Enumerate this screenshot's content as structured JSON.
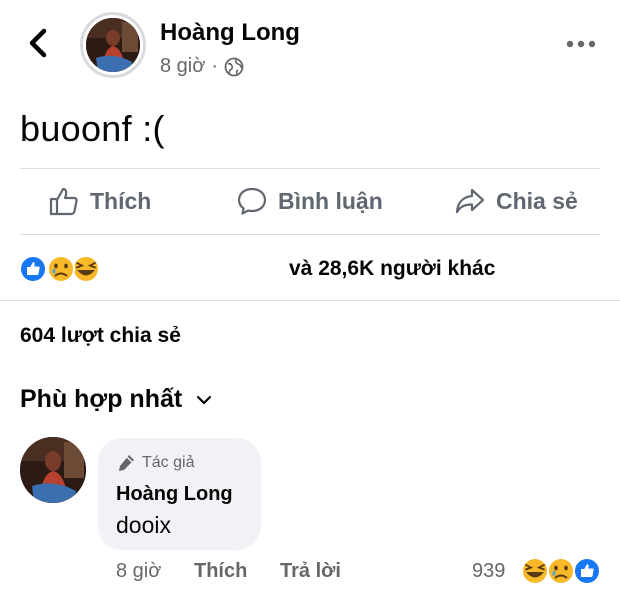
{
  "header": {
    "author_name": "Hoàng Long",
    "time": "8 giờ",
    "separator": "·",
    "icons": {
      "back": "chevron-left-icon",
      "privacy": "globe-icon",
      "more": "more-horizontal-icon"
    }
  },
  "post": {
    "text": "buoonf :("
  },
  "actions": {
    "like_label": "Thích",
    "comment_label": "Bình luận",
    "share_label": "Chia sẻ",
    "icons": {
      "like": "thumbs-up-icon",
      "comment": "comment-icon",
      "share": "share-icon"
    }
  },
  "reactions": {
    "summary": "và 28,6K người khác",
    "types": [
      "like",
      "sad",
      "haha"
    ]
  },
  "shares": {
    "text": "604 lượt chia sẻ"
  },
  "comments_sort": {
    "label": "Phù hợp nhất",
    "icon": "chevron-down-icon"
  },
  "comment": {
    "badge_label": "Tác giả",
    "badge_icon": "pen-icon",
    "author": "Hoàng Long",
    "text": "dooix",
    "time": "8 giờ",
    "like_label": "Thích",
    "reply_label": "Trả lời",
    "reaction_count": "939",
    "reaction_types": [
      "haha",
      "sad",
      "like"
    ]
  },
  "colors": {
    "text": "#050505",
    "secondary": "#65676b",
    "action": "#606770",
    "bubble": "#f0f2f5",
    "divider": "#dadde1",
    "like_blue": "#1877f2",
    "emoji_yellow": "#f7b928"
  }
}
